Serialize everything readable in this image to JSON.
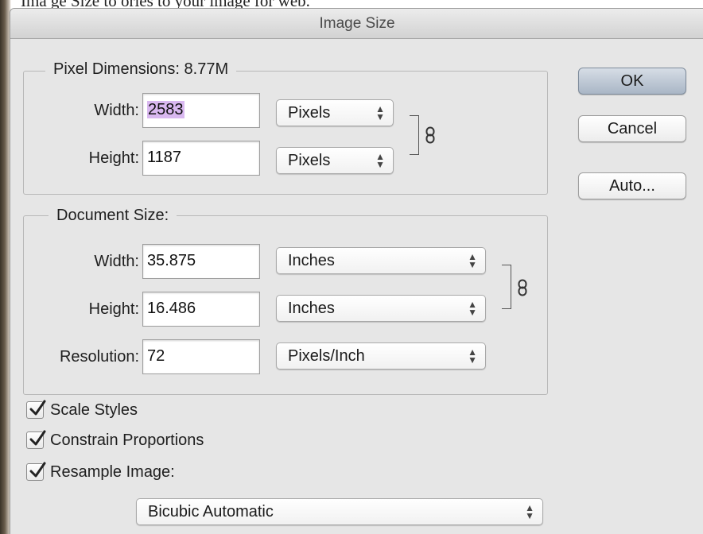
{
  "caption": "Ima ge Size  to  ories  to your image for web.",
  "dialog": {
    "title": "Image Size",
    "pixel_dimensions": {
      "legend": "Pixel Dimensions:",
      "value": "8.77M",
      "width_label": "Width:",
      "width_value": "2583",
      "width_unit": "Pixels",
      "height_label": "Height:",
      "height_value": "1187",
      "height_unit": "Pixels"
    },
    "document_size": {
      "legend": "Document Size:",
      "width_label": "Width:",
      "width_value": "35.875",
      "width_unit": "Inches",
      "height_label": "Height:",
      "height_value": "16.486",
      "height_unit": "Inches",
      "resolution_label": "Resolution:",
      "resolution_value": "72",
      "resolution_unit": "Pixels/Inch"
    },
    "options": {
      "scale_styles": "Scale Styles",
      "scale_styles_checked": true,
      "constrain_proportions": "Constrain Proportions",
      "constrain_proportions_checked": true,
      "resample_image": "Resample Image:",
      "resample_image_checked": true,
      "resample_method": "Bicubic Automatic"
    },
    "buttons": {
      "ok": "OK",
      "cancel": "Cancel",
      "auto": "Auto..."
    }
  },
  "colors": {
    "dialog_bg": "#e6e6e6",
    "selection_highlight": "#d9b8f0",
    "default_button": "#a9b6c6"
  }
}
